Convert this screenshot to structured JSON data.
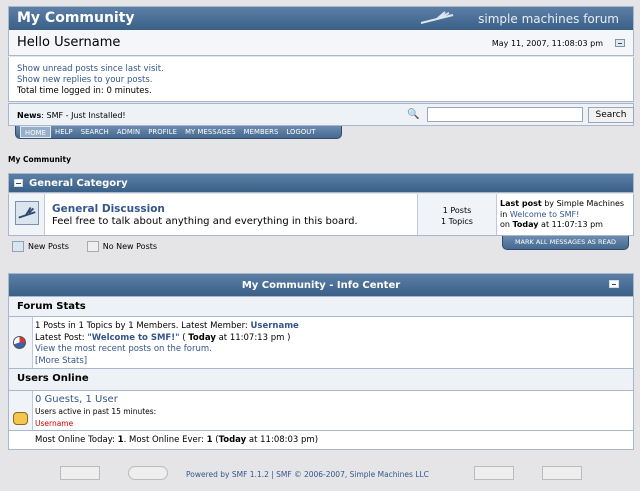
{
  "header": {
    "forum_title": "My Community",
    "brand": "simple machines forum"
  },
  "userbar": {
    "greeting": "Hello",
    "username": "Username",
    "date": "May 11, 2007, 11:08:03 pm"
  },
  "userinfo": {
    "unread_link": "Show unread posts since last visit.",
    "replies_link": "Show new replies to your posts.",
    "time_logged": "Total time logged in: 0 minutes."
  },
  "news": {
    "label": "News",
    "text": ": SMF - Just Installed!"
  },
  "search": {
    "placeholder": "",
    "button": "Search"
  },
  "menu": [
    "HOME",
    "HELP",
    "SEARCH",
    "ADMIN",
    "PROFILE",
    "MY MESSAGES",
    "MEMBERS",
    "LOGOUT"
  ],
  "breadcrumb": "My Community",
  "category": {
    "name": "General Category",
    "board": {
      "name": "General Discussion",
      "description": "Feel free to talk about anything and everything in this board.",
      "posts": "1 Posts",
      "topics": "1 Topics",
      "last_post_label": "Last post",
      "last_post_by": " by Simple Machines",
      "last_post_in": "in ",
      "last_post_topic": "Welcome to SMF!",
      "last_post_on": "on ",
      "last_post_today": "Today",
      "last_post_time": " at 11:07:13 pm"
    }
  },
  "mark_read_button": "MARK ALL MESSAGES AS READ",
  "legend": {
    "new_posts": "New Posts",
    "no_new_posts": "No New Posts"
  },
  "info_center": {
    "title": "My Community - Info Center",
    "forum_stats_title": "Forum Stats",
    "stats_line1_prefix": "1 Posts in 1 Topics by 1 Members. Latest Member: ",
    "stats_latest_member": "Username",
    "stats_line2_prefix": "Latest Post: ",
    "stats_latest_post": "\"Welcome to SMF!\"",
    "stats_line2_mid": " ( ",
    "stats_today": "Today",
    "stats_line2_suffix": " at 11:07:13 pm )",
    "recent_posts_link": "View the most recent posts on the forum.",
    "more_stats_link": "[More Stats]",
    "users_online_title": "Users Online",
    "guests_users": "0 Guests, 1 User",
    "active_label": "Users active in past 15 minutes:",
    "online_username": "Username",
    "most_online_prefix": "Most Online Today: ",
    "most_online_today": "1",
    "most_online_mid": ". Most Online Ever: ",
    "most_online_ever": "1",
    "most_online_paren": " (",
    "most_online_when": "Today",
    "most_online_suffix": " at 11:08:03 pm)"
  },
  "footer": {
    "credits": "Powered by SMF 1.1.2 | SMF © 2006-2007, Simple Machines LLC"
  },
  "colors": {
    "header_blue": "#3a6088",
    "link_blue": "#34558b",
    "online_red": "#cc0000"
  }
}
